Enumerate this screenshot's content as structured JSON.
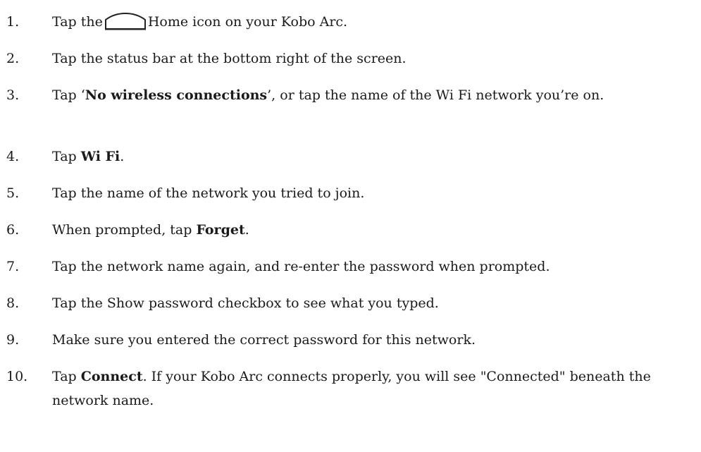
{
  "steps": [
    {
      "number": "1.",
      "pre": "Tap the",
      "icon": "home-icon",
      "post": "Home icon on your Kobo Arc."
    },
    {
      "number": "2.",
      "text": "Tap the status bar at the bottom right of the screen."
    },
    {
      "number": "3.",
      "pre": "Tap ‘",
      "bold": "No wireless connections",
      "post": "’, or tap the name of the Wi Fi network you’re on."
    },
    {
      "number": "4.",
      "pre": "Tap ",
      "bold": "Wi Fi",
      "post": "."
    },
    {
      "number": "5.",
      "text": "Tap the name of the network you tried to join."
    },
    {
      "number": "6.",
      "pre": "When prompted, tap ",
      "bold": "Forget",
      "post": "."
    },
    {
      "number": "7.",
      "text": "Tap the network name again, and re-enter the password when prompted."
    },
    {
      "number": "8.",
      "text": "Tap the Show password checkbox to see what you typed."
    },
    {
      "number": "9.",
      "text": "Make sure you entered the correct password for this network."
    },
    {
      "number": "10.",
      "pre": "Tap ",
      "bold": "Connect",
      "post": ". If your Kobo Arc connects properly, you will see \"Connected\" beneath the network name."
    }
  ]
}
